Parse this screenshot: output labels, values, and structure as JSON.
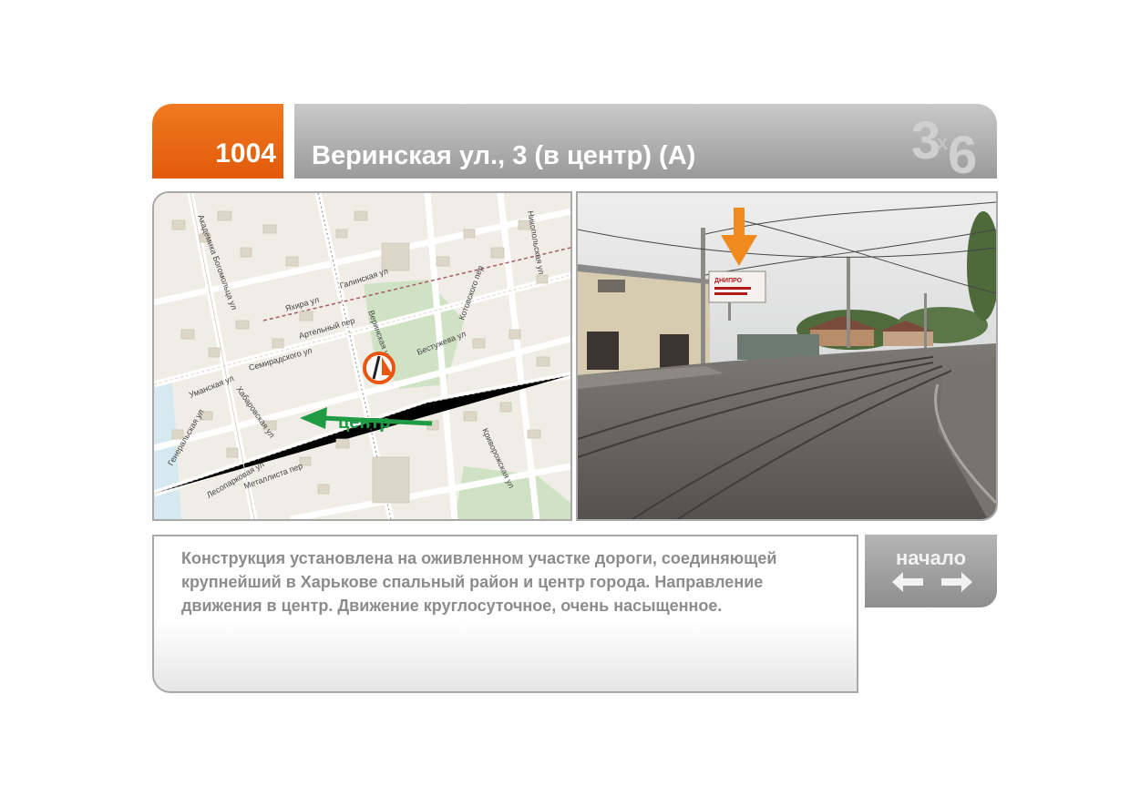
{
  "header": {
    "code": "1004",
    "title": "Веринская ул., 3  (в центр)  (А)",
    "logo_text": "3х6"
  },
  "map": {
    "direction_label": "центр",
    "street_labels": [
      "Яхира ул",
      "Галинская ул",
      "Бестужева ул",
      "Семирадского ул",
      "Котовского пер",
      "Никопольская ул",
      "Академика Богомольца ул",
      "Артельный пер",
      "Хабаровская ул",
      "Металлиста пер",
      "Уманская ул",
      "Веринская ул",
      "Криворожская ул",
      "Генеральская ул",
      "Лесопарковая ул"
    ]
  },
  "photo": {
    "billboard_text": "ДНИПРО"
  },
  "description": "Конструкция установлена на оживленном участке дороги, соединяющей крупнейший в Харькове спальный район и центр города. Направление движения в центр.  Движение круглосуточное, очень насыщенное.",
  "nav": {
    "label": "начало",
    "prev_icon": "arrow-left-icon",
    "next_icon": "arrow-right-icon"
  },
  "colors": {
    "accent": "#e8660f",
    "header_gray": "#a6a6a6",
    "direction_green": "#1f9a45",
    "pointer_orange": "#f08a1c"
  }
}
